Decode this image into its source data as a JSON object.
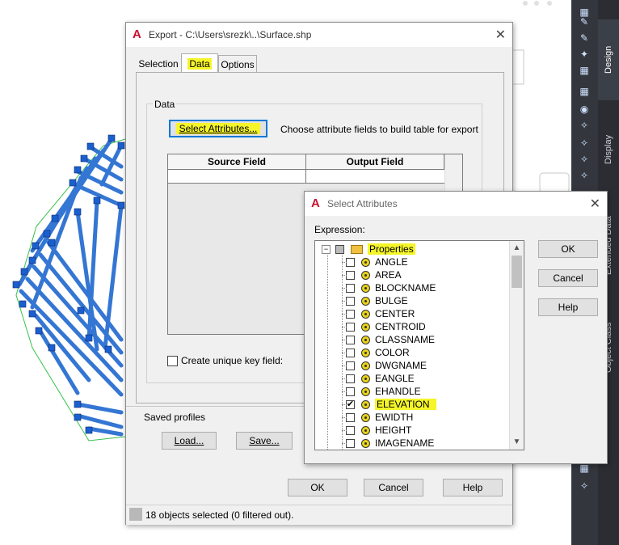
{
  "palette": {
    "tabs": [
      "Design",
      "Display",
      "Extended Data",
      "Object Class"
    ],
    "icons": [
      "layer-icon",
      "pen-icon",
      "edit-icon",
      "grid-icon",
      "globe-icon",
      "wand-icon",
      "wand-a-icon",
      "wand-b-icon",
      "wand-c-icon",
      "wand-d-icon"
    ]
  },
  "export_dialog": {
    "title": "Export - C:\\Users\\srezk\\..\\Surface.shp",
    "tabs": [
      "Selection",
      "Data",
      "Options"
    ],
    "active_tab": "Data",
    "group_label": "Data",
    "select_attributes_button": "Select Attributes...",
    "instruction": "Choose attribute fields to build table for export",
    "table": {
      "headers": [
        "Source Field",
        "Output Field"
      ]
    },
    "unique_key_label": "Create unique key field:",
    "saved_profiles_label": "Saved profiles",
    "load_button": "Load...",
    "save_button": "Save...",
    "ok_button": "OK",
    "cancel_button": "Cancel",
    "help_button": "Help",
    "status": "18 objects selected (0 filtered out)."
  },
  "select_attributes": {
    "title": "Select Attributes",
    "expression_label": "Expression:",
    "root": "Properties",
    "items": [
      {
        "name": "ANGLE",
        "checked": false
      },
      {
        "name": "AREA",
        "checked": false
      },
      {
        "name": "BLOCKNAME",
        "checked": false
      },
      {
        "name": "BULGE",
        "checked": false
      },
      {
        "name": "CENTER",
        "checked": false
      },
      {
        "name": "CENTROID",
        "checked": false
      },
      {
        "name": "CLASSNAME",
        "checked": false
      },
      {
        "name": "COLOR",
        "checked": false
      },
      {
        "name": "DWGNAME",
        "checked": false
      },
      {
        "name": "EANGLE",
        "checked": false
      },
      {
        "name": "EHANDLE",
        "checked": false
      },
      {
        "name": "ELEVATION",
        "checked": true
      },
      {
        "name": "EWIDTH",
        "checked": false
      },
      {
        "name": "HEIGHT",
        "checked": false
      },
      {
        "name": "IMAGENAME",
        "checked": false
      }
    ],
    "ok_button": "OK",
    "cancel_button": "Cancel",
    "help_button": "Help"
  },
  "colors": {
    "highlight": "#f5f52a",
    "accent_red": "#c8102e",
    "select_blue": "#0078d7"
  }
}
